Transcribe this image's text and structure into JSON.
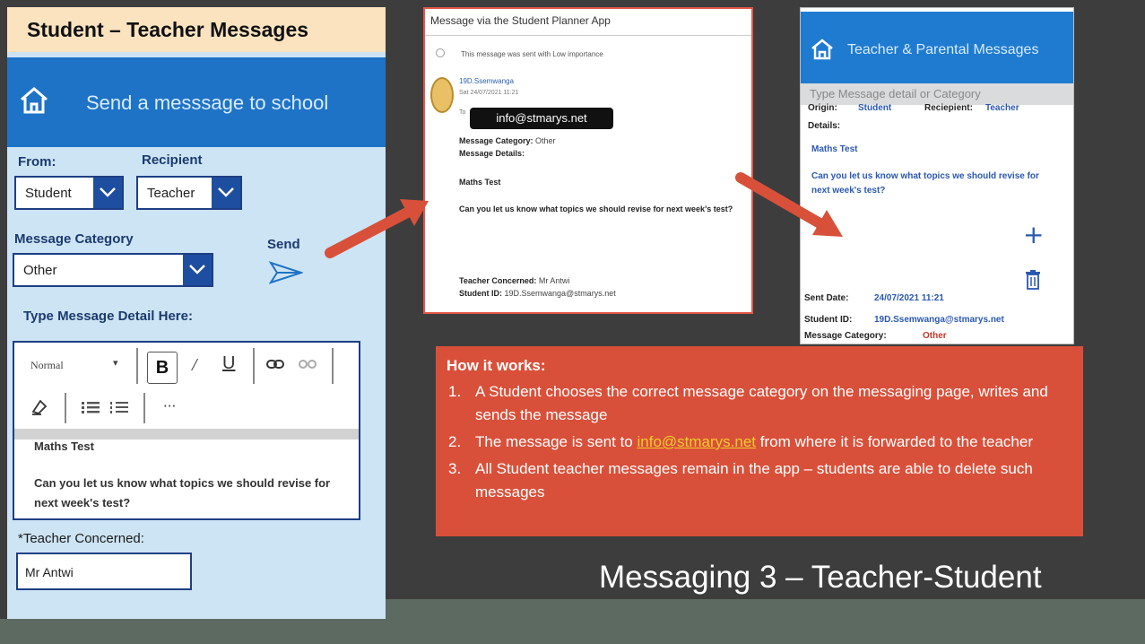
{
  "slide": {
    "title": "Messaging 3 – Teacher-Student"
  },
  "left_app": {
    "title_strip": "Student – Teacher Messages",
    "header_title": "Send a messsage to school",
    "from_label": "From:",
    "from_value": "Student",
    "recipient_label": "Recipient",
    "recipient_value": "Teacher",
    "category_label": "Message Category",
    "category_value": "Other",
    "send_label": "Send",
    "detail_label": "Type Message Detail Here:",
    "editor": {
      "style_value": "Normal",
      "caret": "▾",
      "bold": "B",
      "italic": "/",
      "underline": "U",
      "more": "···",
      "line1": "Maths Test",
      "line2": "Can you let us know what topics we should revise for next week's test?"
    },
    "teacher_label": "*Teacher Concerned:",
    "teacher_value": "Mr Antwi"
  },
  "email": {
    "header": "Message via the Student Planner App",
    "importance_note": "This message was sent with Low importance",
    "from": "19D.Ssemwanga",
    "date": "Sat 24/07/2021 11:21",
    "to_prefix": "To",
    "to_address": "info@stmarys.net",
    "category_label": "Message Category:",
    "category_value": "Other",
    "details_label": "Message Details:",
    "line1": "Maths Test",
    "line2": "Can you let us know what topics we should revise for next week's test?",
    "teacher_label": "Teacher Concerned:",
    "teacher_value": "Mr Antwi",
    "student_label": "Student ID:",
    "student_value": "19D.Ssemwanga@stmarys.net"
  },
  "right_app": {
    "header_title": "Teacher & Parental Messages",
    "search_placeholder": "Type Message detail or Category",
    "origin_label": "Origin:",
    "origin_value": "Student",
    "recipient_label": "Reciepient:",
    "recipient_value": "Teacher",
    "details_label": "Details:",
    "line1": "Maths Test",
    "line2": "Can you let us know what topics we should revise for next week's test?",
    "sent_label": "Sent Date:",
    "sent_value": "24/07/2021 11:21",
    "student_label": "Student ID:",
    "student_value": "19D.Ssemwanga@stmarys.net",
    "category_label": "Message Category:",
    "category_value": "Other",
    "plus": "+"
  },
  "info": {
    "title": "How it works:",
    "items": [
      {
        "num": "1.",
        "text": "A Student  chooses the correct message category on the messaging page, writes and sends the message"
      },
      {
        "num": "2.",
        "pre": "The message is sent to ",
        "link": "info@stmarys.net",
        "post": "  from where it is forwarded to the teacher"
      },
      {
        "num": "3.",
        "text": "All Student teacher messages remain in the app – students are able to delete such messages"
      }
    ]
  },
  "colors": {
    "accent_blue": "#1f73c6",
    "info_bg": "#d9503a",
    "arrow": "#d9503a",
    "link": "#f2cb2a"
  }
}
